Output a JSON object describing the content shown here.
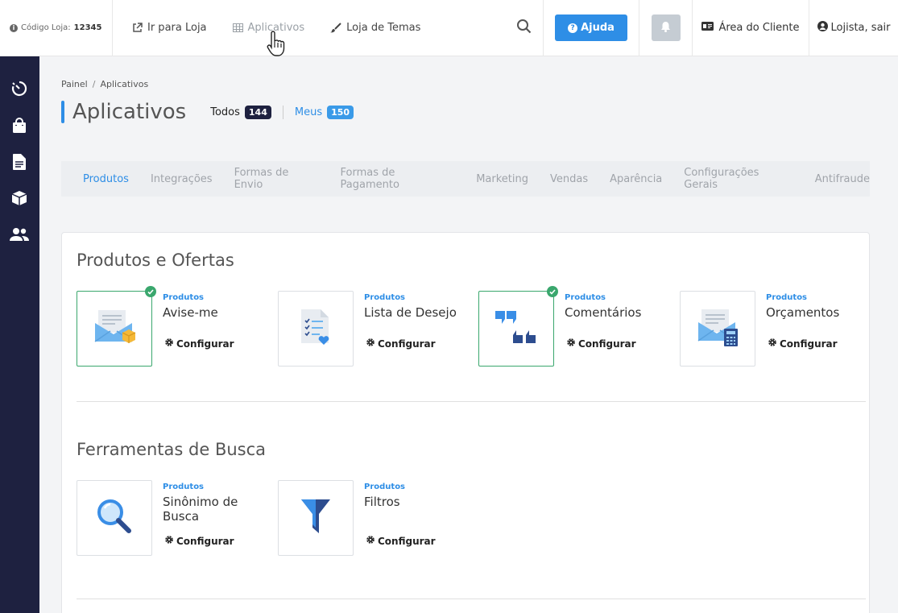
{
  "topbar": {
    "store_code_label": "Código Loja:",
    "store_code_value": "12345",
    "links": [
      {
        "label": "Ir para Loja",
        "icon": "external-link-icon"
      },
      {
        "label": "Aplicativos",
        "icon": "grid-icon"
      },
      {
        "label": "Loja de Temas",
        "icon": "brush-icon"
      }
    ],
    "help_label": "Ajuda",
    "client_area_label": "Área do Cliente",
    "user_label": "Lojista, sair"
  },
  "sidebar": {
    "icons": [
      "stopwatch-icon",
      "shopping-bag-icon",
      "document-icon",
      "box-icon",
      "users-icon"
    ]
  },
  "breadcrumb": [
    "Painel",
    "Aplicativos"
  ],
  "page": {
    "title": "Aplicativos",
    "all_label": "Todos",
    "all_count": "144",
    "mine_label": "Meus",
    "mine_count": "150"
  },
  "categories": [
    "Produtos",
    "Integrações",
    "Formas de Envio",
    "Formas de Pagamento",
    "Marketing",
    "Vendas",
    "Aparência",
    "Configurações Gerais",
    "Antifraude"
  ],
  "sections": [
    {
      "title": "Produtos e Ofertas",
      "apps": [
        {
          "category": "Produtos",
          "name": "Avise-me",
          "config": "Configurar",
          "installed": true,
          "icon": "envelope-package-icon"
        },
        {
          "category": "Produtos",
          "name": "Lista de Desejo",
          "config": "Configurar",
          "installed": false,
          "icon": "wishlist-icon"
        },
        {
          "category": "Produtos",
          "name": "Comentários",
          "config": "Configurar",
          "installed": true,
          "icon": "comments-icon"
        },
        {
          "category": "Produtos",
          "name": "Orçamentos",
          "config": "Configurar",
          "installed": false,
          "icon": "envelope-calculator-icon"
        }
      ]
    },
    {
      "title": "Ferramentas de Busca",
      "apps": [
        {
          "category": "Produtos",
          "name": "Sinônimo de Busca",
          "config": "Configurar",
          "installed": false,
          "icon": "magnifier-icon"
        },
        {
          "category": "Produtos",
          "name": "Filtros",
          "config": "Configurar",
          "installed": false,
          "icon": "funnel-icon"
        }
      ]
    }
  ],
  "colors": {
    "accent": "#2e8ee6",
    "sidebar": "#1e2140",
    "installed": "#3aa76d"
  }
}
